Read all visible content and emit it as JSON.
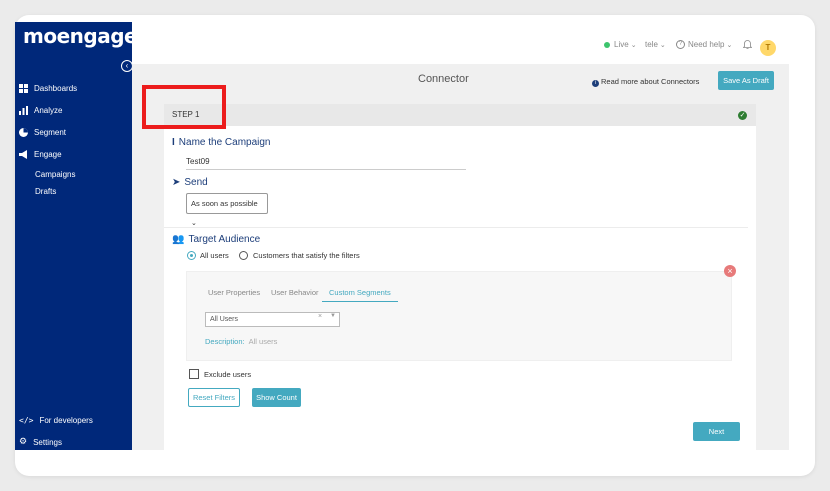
{
  "sidebar": {
    "logo": "moengage",
    "items": [
      {
        "label": "Dashboards",
        "icon": "dashboard-icon"
      },
      {
        "label": "Analyze",
        "icon": "bar-chart-icon"
      },
      {
        "label": "Segment",
        "icon": "pie-chart-icon"
      },
      {
        "label": "Engage",
        "icon": "megaphone-icon"
      }
    ],
    "sub_items": [
      "Campaigns",
      "Drafts"
    ],
    "footer": [
      {
        "label": "For developers",
        "icon": "code-icon"
      },
      {
        "label": "Settings",
        "icon": "gear-icon"
      }
    ]
  },
  "topbar": {
    "live": "Live",
    "workspace": "tele",
    "help": "Need help",
    "avatar": "T"
  },
  "header": {
    "title": "Connector",
    "read_more": "Read more about Connectors",
    "save_draft": "Save As Draft"
  },
  "step": {
    "label": "STEP 1"
  },
  "name_section": {
    "title": "Name the Campaign",
    "value": "Test09"
  },
  "send_section": {
    "title": "Send",
    "selected": "As soon as possible"
  },
  "audience": {
    "title": "Target Audience",
    "option_all": "All users",
    "option_filters": "Customers that satisfy the filters",
    "tabs": [
      "User Properties",
      "User Behavior",
      "Custom Segments"
    ],
    "segment_value": "All Users",
    "description_label": "Description:",
    "description_value": "All users",
    "exclude_label": "Exclude users",
    "reset_label": "Reset Filters",
    "show_count_label": "Show Count"
  },
  "footer": {
    "next_label": "Next"
  },
  "colors": {
    "sidebar": "#00287a",
    "accent": "#44a9c0",
    "highlight": "#ec1c1c"
  }
}
